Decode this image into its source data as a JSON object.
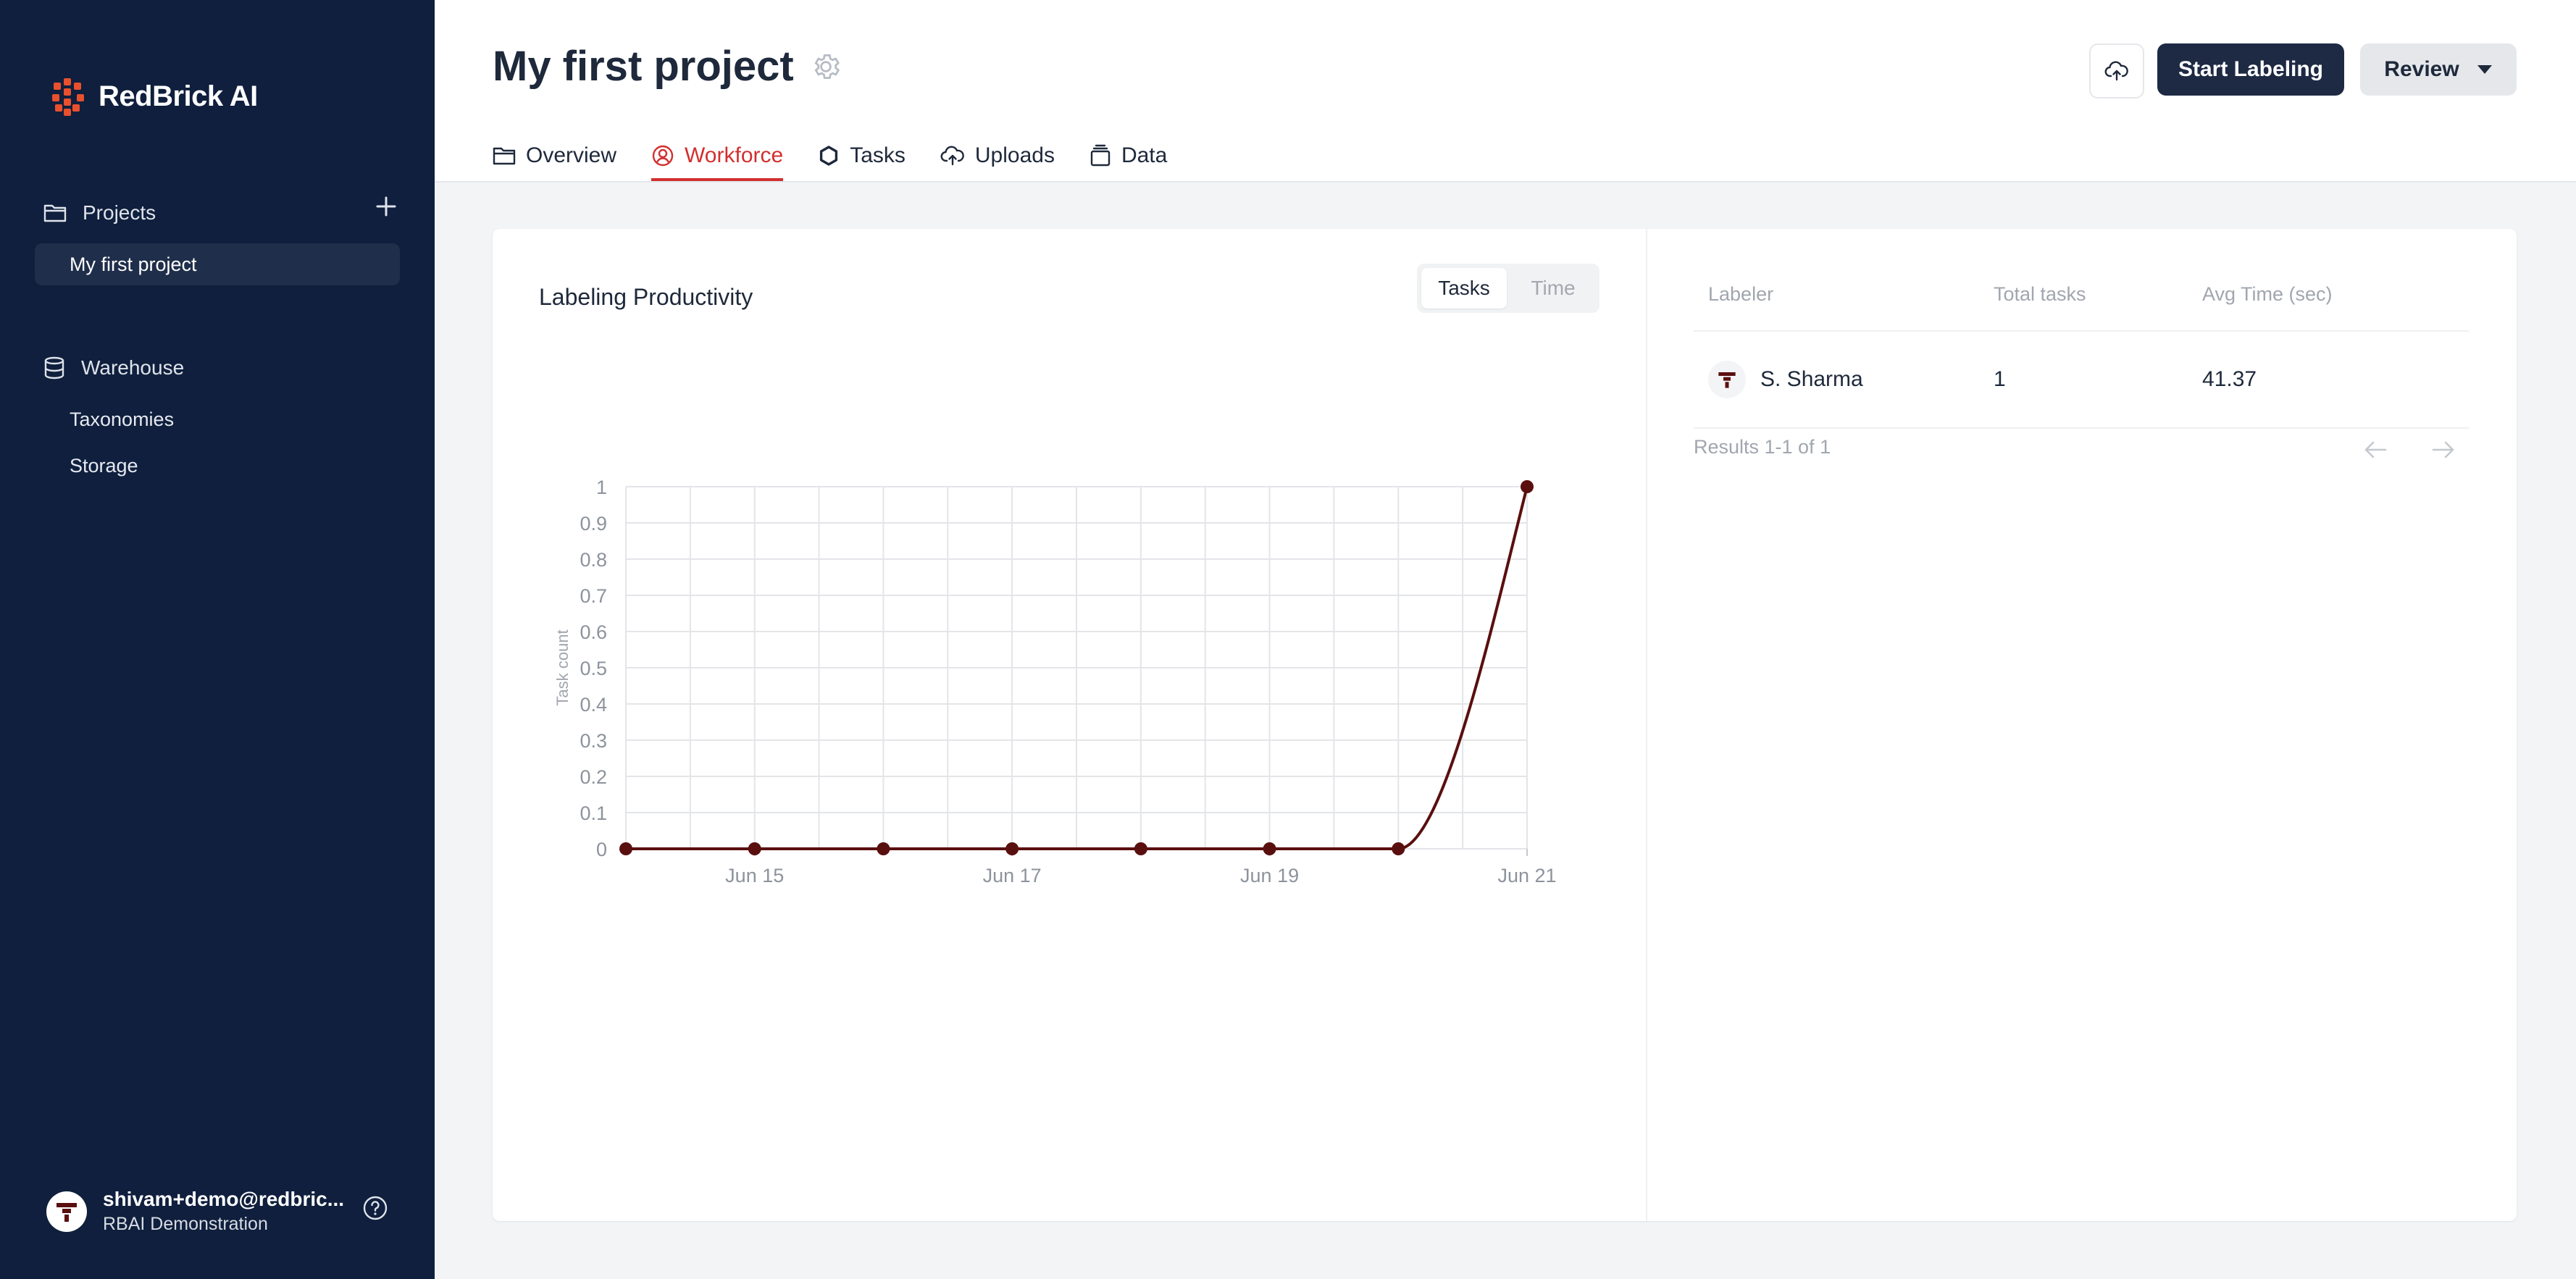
{
  "sidebar": {
    "brand": "RedBrick AI",
    "projects_label": "Projects",
    "active_project": "My first project",
    "warehouse_label": "Warehouse",
    "warehouse_items": [
      "Taxonomies",
      "Storage"
    ],
    "user": {
      "email": "shivam+demo@redbric...",
      "org": "RBAI Demonstration"
    }
  },
  "header": {
    "title": "My first project",
    "tabs": [
      {
        "label": "Overview",
        "icon": "folder-icon"
      },
      {
        "label": "Workforce",
        "icon": "user-circle-icon",
        "active": true
      },
      {
        "label": "Tasks",
        "icon": "hexagon-icon"
      },
      {
        "label": "Uploads",
        "icon": "cloud-upload-icon"
      },
      {
        "label": "Data",
        "icon": "stack-icon"
      }
    ],
    "start_labeling": "Start Labeling",
    "review": "Review"
  },
  "productivity": {
    "title": "Labeling Productivity",
    "toggle": {
      "tasks": "Tasks",
      "time": "Time"
    }
  },
  "chart_data": {
    "type": "line",
    "title": "Labeling Productivity",
    "xlabel": "",
    "ylabel": "Task count",
    "x": [
      "Jun 14",
      "Jun 15",
      "Jun 16",
      "Jun 17",
      "Jun 18",
      "Jun 19",
      "Jun 20",
      "Jun 21"
    ],
    "x_tick_labels": [
      "Jun 15",
      "Jun 17",
      "Jun 19",
      "Jun 21"
    ],
    "y_ticks": [
      "0",
      "0.1",
      "0.2",
      "0.3",
      "0.4",
      "0.5",
      "0.6",
      "0.7",
      "0.8",
      "0.9",
      "1"
    ],
    "ylim": [
      0,
      1
    ],
    "grid": true,
    "series": [
      {
        "values": [
          0,
          0,
          0,
          0,
          0,
          0,
          0,
          1
        ],
        "color": "#5a0f0f"
      }
    ]
  },
  "table": {
    "headers": [
      "Labeler",
      "Total tasks",
      "Avg Time (sec)"
    ],
    "rows": [
      {
        "labeler": "S. Sharma",
        "total": "1",
        "avg": "41.37"
      }
    ],
    "results": "Results 1-1 of 1"
  },
  "colors": {
    "sidebar": "#0f1f3d",
    "accent": "#d32f2f",
    "line": "#5a0f0f"
  }
}
